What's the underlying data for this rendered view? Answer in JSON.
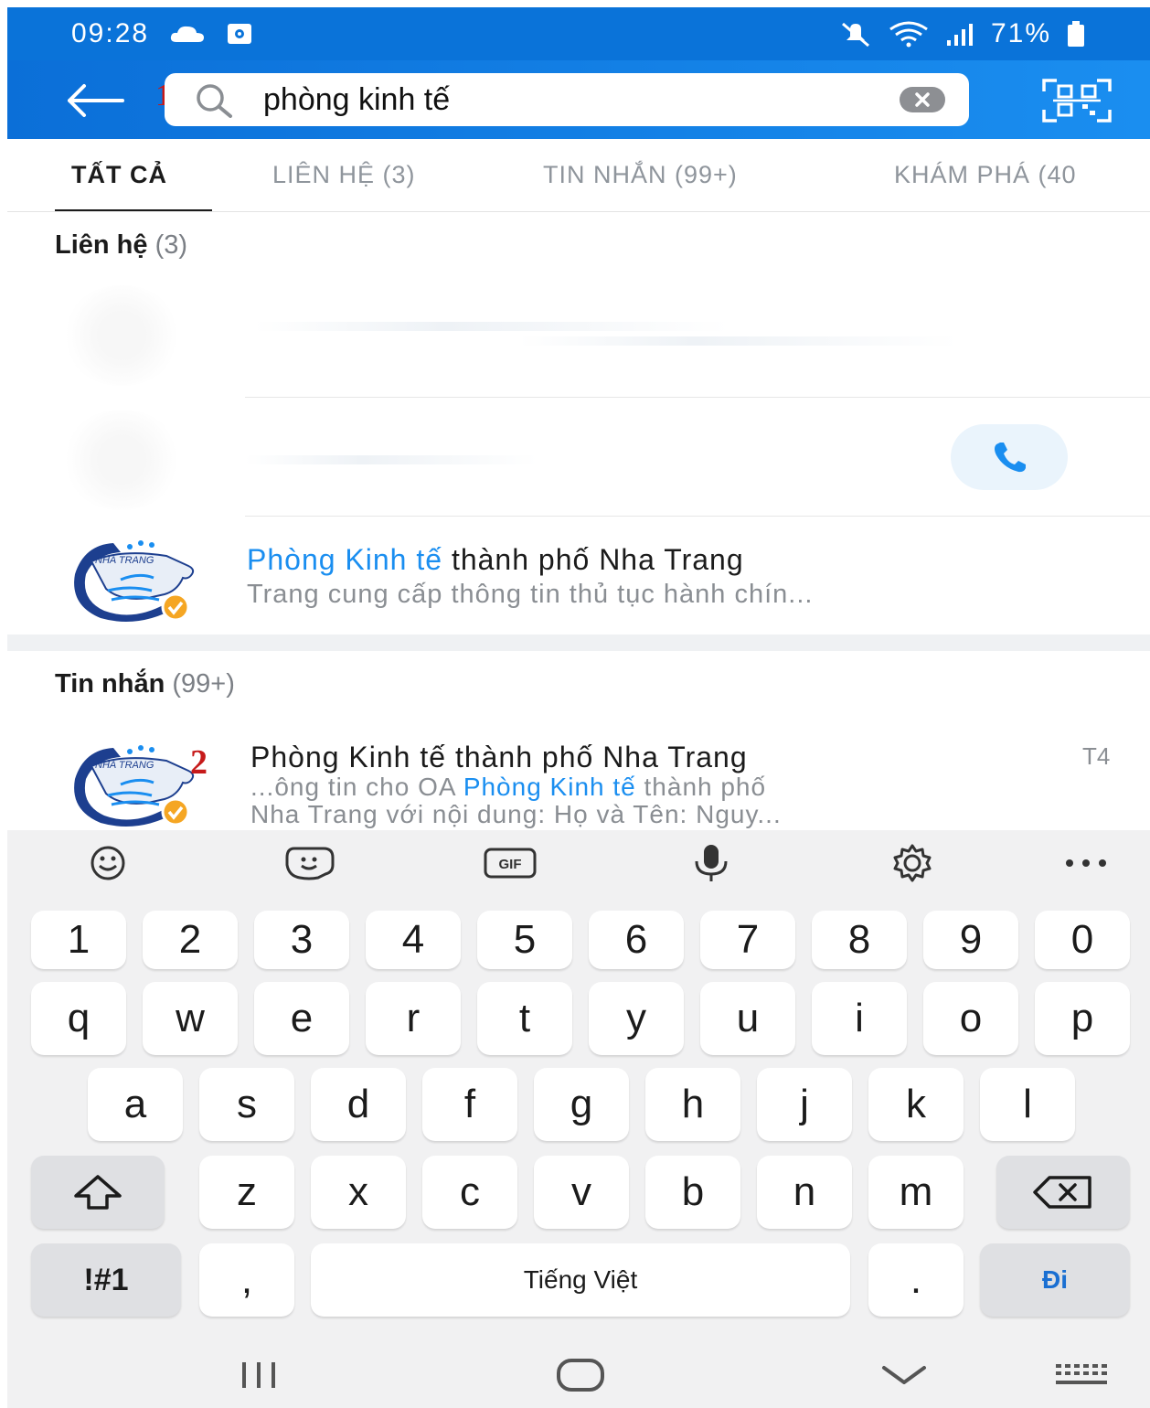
{
  "status_bar": {
    "time": "09:28",
    "battery": "71%",
    "icons": [
      "cloud-icon",
      "media-icon",
      "mute-icon",
      "wifi-icon",
      "signal-icon",
      "battery-icon"
    ]
  },
  "search": {
    "query": "phòng kinh tế",
    "annotation_marker": "1"
  },
  "tabs": [
    {
      "label": "TẤT CẢ",
      "active": true
    },
    {
      "label": "LIÊN HỆ (3)",
      "active": false
    },
    {
      "label": "TIN NHẮN (99+)",
      "active": false
    },
    {
      "label": "KHÁM PHÁ (40",
      "active": false
    }
  ],
  "contacts_section": {
    "title": "Liên hệ",
    "count": "(3)",
    "result": {
      "name_highlight": "Phòng Kinh tế",
      "name_rest": " thành phố Nha Trang",
      "description": "Trang cung cấp thông tin thủ tục hành chín..."
    }
  },
  "messages_section": {
    "title": "Tin nhắn",
    "count": "(99+)",
    "annotation_marker": "2",
    "result": {
      "name": "Phòng Kinh tế thành phố Nha Trang",
      "time": "T4",
      "snippet_prefix": "...ông tin cho OA ",
      "snippet_highlight": "Phòng Kinh tế",
      "snippet_suffix": " thành phố",
      "snippet_line2": "Nha Trang với nội dung: Họ và Tên: Nguy..."
    }
  },
  "logo_text": "NHA TRANG",
  "keyboard": {
    "row_numbers": [
      "1",
      "2",
      "3",
      "4",
      "5",
      "6",
      "7",
      "8",
      "9",
      "0"
    ],
    "row_q": [
      "q",
      "w",
      "e",
      "r",
      "t",
      "y",
      "u",
      "i",
      "o",
      "p"
    ],
    "row_a": [
      "a",
      "s",
      "d",
      "f",
      "g",
      "h",
      "j",
      "k",
      "l"
    ],
    "row_z": [
      "z",
      "x",
      "c",
      "v",
      "b",
      "n",
      "m"
    ],
    "symbols_label": "!#1",
    "comma": ",",
    "space_label": "Tiếng Việt",
    "period": ".",
    "go_label": "Đi"
  },
  "colors": {
    "header_blue": "#0a73d9",
    "highlight_blue": "#1a8ef0",
    "annotation_red": "#c61a1a"
  }
}
